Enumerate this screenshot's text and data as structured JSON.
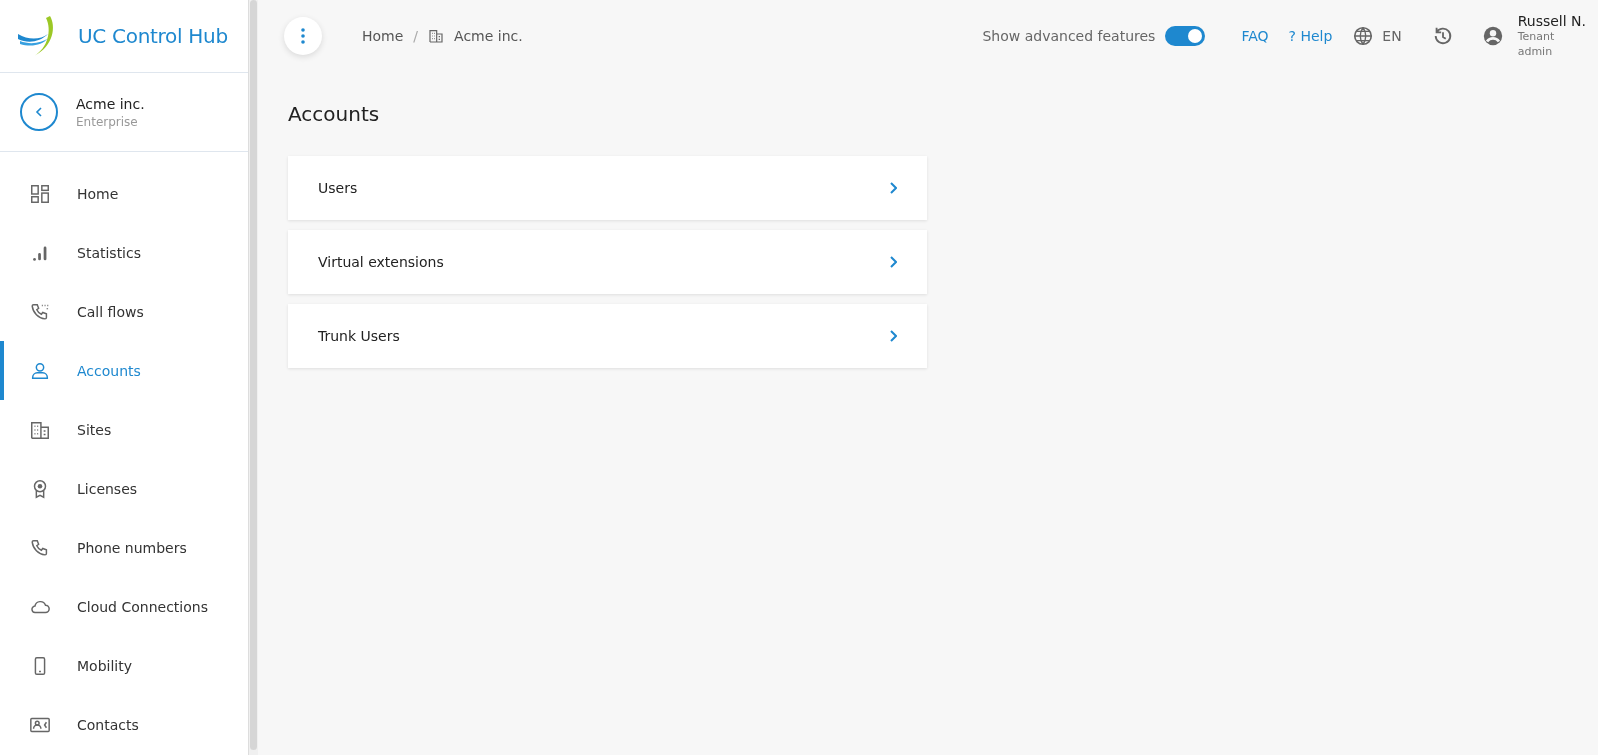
{
  "sidebar": {
    "logo_text": "UC Control Hub",
    "tenant": {
      "name": "Acme inc.",
      "type": "Enterprise"
    },
    "items": [
      {
        "label": "Home",
        "selected": false
      },
      {
        "label": "Statistics",
        "selected": false
      },
      {
        "label": "Call flows",
        "selected": false
      },
      {
        "label": "Accounts",
        "selected": true
      },
      {
        "label": "Sites",
        "selected": false
      },
      {
        "label": "Licenses",
        "selected": false
      },
      {
        "label": "Phone numbers",
        "selected": false
      },
      {
        "label": "Cloud Connections",
        "selected": false
      },
      {
        "label": "Mobility",
        "selected": false
      },
      {
        "label": "Contacts",
        "selected": false
      }
    ]
  },
  "topbar": {
    "breadcrumb": [
      {
        "label": "Home"
      },
      {
        "label": "Acme inc."
      }
    ],
    "breadcrumb_separator": "/",
    "advanced_toggle": {
      "label": "Show advanced features",
      "on": true
    },
    "faq": "FAQ",
    "help": {
      "mark": "?",
      "label": "Help"
    },
    "language": "EN",
    "user": {
      "name": "Russell N.",
      "role": "Tenant admin"
    }
  },
  "page": {
    "title": "Accounts",
    "cards": [
      {
        "label": "Users"
      },
      {
        "label": "Virtual extensions"
      },
      {
        "label": "Trunk Users"
      }
    ]
  }
}
